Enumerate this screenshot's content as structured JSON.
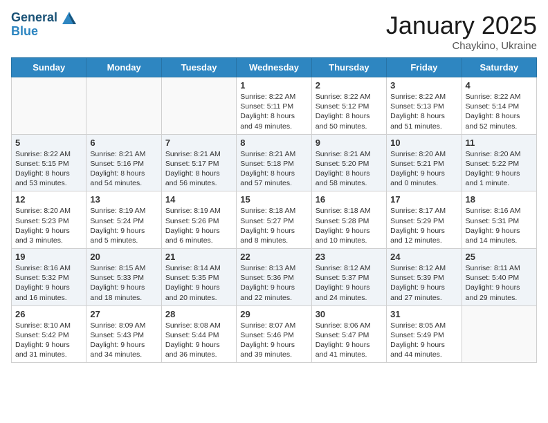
{
  "header": {
    "logo_line1": "General",
    "logo_line2": "Blue",
    "title": "January 2025",
    "subtitle": "Chaykino, Ukraine"
  },
  "days_of_week": [
    "Sunday",
    "Monday",
    "Tuesday",
    "Wednesday",
    "Thursday",
    "Friday",
    "Saturday"
  ],
  "weeks": [
    [
      {
        "day": "",
        "content": []
      },
      {
        "day": "",
        "content": []
      },
      {
        "day": "",
        "content": []
      },
      {
        "day": "1",
        "content": [
          "Sunrise: 8:22 AM",
          "Sunset: 5:11 PM",
          "Daylight: 8 hours",
          "and 49 minutes."
        ]
      },
      {
        "day": "2",
        "content": [
          "Sunrise: 8:22 AM",
          "Sunset: 5:12 PM",
          "Daylight: 8 hours",
          "and 50 minutes."
        ]
      },
      {
        "day": "3",
        "content": [
          "Sunrise: 8:22 AM",
          "Sunset: 5:13 PM",
          "Daylight: 8 hours",
          "and 51 minutes."
        ]
      },
      {
        "day": "4",
        "content": [
          "Sunrise: 8:22 AM",
          "Sunset: 5:14 PM",
          "Daylight: 8 hours",
          "and 52 minutes."
        ]
      }
    ],
    [
      {
        "day": "5",
        "content": [
          "Sunrise: 8:22 AM",
          "Sunset: 5:15 PM",
          "Daylight: 8 hours",
          "and 53 minutes."
        ]
      },
      {
        "day": "6",
        "content": [
          "Sunrise: 8:21 AM",
          "Sunset: 5:16 PM",
          "Daylight: 8 hours",
          "and 54 minutes."
        ]
      },
      {
        "day": "7",
        "content": [
          "Sunrise: 8:21 AM",
          "Sunset: 5:17 PM",
          "Daylight: 8 hours",
          "and 56 minutes."
        ]
      },
      {
        "day": "8",
        "content": [
          "Sunrise: 8:21 AM",
          "Sunset: 5:18 PM",
          "Daylight: 8 hours",
          "and 57 minutes."
        ]
      },
      {
        "day": "9",
        "content": [
          "Sunrise: 8:21 AM",
          "Sunset: 5:20 PM",
          "Daylight: 8 hours",
          "and 58 minutes."
        ]
      },
      {
        "day": "10",
        "content": [
          "Sunrise: 8:20 AM",
          "Sunset: 5:21 PM",
          "Daylight: 9 hours",
          "and 0 minutes."
        ]
      },
      {
        "day": "11",
        "content": [
          "Sunrise: 8:20 AM",
          "Sunset: 5:22 PM",
          "Daylight: 9 hours",
          "and 1 minute."
        ]
      }
    ],
    [
      {
        "day": "12",
        "content": [
          "Sunrise: 8:20 AM",
          "Sunset: 5:23 PM",
          "Daylight: 9 hours",
          "and 3 minutes."
        ]
      },
      {
        "day": "13",
        "content": [
          "Sunrise: 8:19 AM",
          "Sunset: 5:24 PM",
          "Daylight: 9 hours",
          "and 5 minutes."
        ]
      },
      {
        "day": "14",
        "content": [
          "Sunrise: 8:19 AM",
          "Sunset: 5:26 PM",
          "Daylight: 9 hours",
          "and 6 minutes."
        ]
      },
      {
        "day": "15",
        "content": [
          "Sunrise: 8:18 AM",
          "Sunset: 5:27 PM",
          "Daylight: 9 hours",
          "and 8 minutes."
        ]
      },
      {
        "day": "16",
        "content": [
          "Sunrise: 8:18 AM",
          "Sunset: 5:28 PM",
          "Daylight: 9 hours",
          "and 10 minutes."
        ]
      },
      {
        "day": "17",
        "content": [
          "Sunrise: 8:17 AM",
          "Sunset: 5:29 PM",
          "Daylight: 9 hours",
          "and 12 minutes."
        ]
      },
      {
        "day": "18",
        "content": [
          "Sunrise: 8:16 AM",
          "Sunset: 5:31 PM",
          "Daylight: 9 hours",
          "and 14 minutes."
        ]
      }
    ],
    [
      {
        "day": "19",
        "content": [
          "Sunrise: 8:16 AM",
          "Sunset: 5:32 PM",
          "Daylight: 9 hours",
          "and 16 minutes."
        ]
      },
      {
        "day": "20",
        "content": [
          "Sunrise: 8:15 AM",
          "Sunset: 5:33 PM",
          "Daylight: 9 hours",
          "and 18 minutes."
        ]
      },
      {
        "day": "21",
        "content": [
          "Sunrise: 8:14 AM",
          "Sunset: 5:35 PM",
          "Daylight: 9 hours",
          "and 20 minutes."
        ]
      },
      {
        "day": "22",
        "content": [
          "Sunrise: 8:13 AM",
          "Sunset: 5:36 PM",
          "Daylight: 9 hours",
          "and 22 minutes."
        ]
      },
      {
        "day": "23",
        "content": [
          "Sunrise: 8:12 AM",
          "Sunset: 5:37 PM",
          "Daylight: 9 hours",
          "and 24 minutes."
        ]
      },
      {
        "day": "24",
        "content": [
          "Sunrise: 8:12 AM",
          "Sunset: 5:39 PM",
          "Daylight: 9 hours",
          "and 27 minutes."
        ]
      },
      {
        "day": "25",
        "content": [
          "Sunrise: 8:11 AM",
          "Sunset: 5:40 PM",
          "Daylight: 9 hours",
          "and 29 minutes."
        ]
      }
    ],
    [
      {
        "day": "26",
        "content": [
          "Sunrise: 8:10 AM",
          "Sunset: 5:42 PM",
          "Daylight: 9 hours",
          "and 31 minutes."
        ]
      },
      {
        "day": "27",
        "content": [
          "Sunrise: 8:09 AM",
          "Sunset: 5:43 PM",
          "Daylight: 9 hours",
          "and 34 minutes."
        ]
      },
      {
        "day": "28",
        "content": [
          "Sunrise: 8:08 AM",
          "Sunset: 5:44 PM",
          "Daylight: 9 hours",
          "and 36 minutes."
        ]
      },
      {
        "day": "29",
        "content": [
          "Sunrise: 8:07 AM",
          "Sunset: 5:46 PM",
          "Daylight: 9 hours",
          "and 39 minutes."
        ]
      },
      {
        "day": "30",
        "content": [
          "Sunrise: 8:06 AM",
          "Sunset: 5:47 PM",
          "Daylight: 9 hours",
          "and 41 minutes."
        ]
      },
      {
        "day": "31",
        "content": [
          "Sunrise: 8:05 AM",
          "Sunset: 5:49 PM",
          "Daylight: 9 hours",
          "and 44 minutes."
        ]
      },
      {
        "day": "",
        "content": []
      }
    ]
  ]
}
